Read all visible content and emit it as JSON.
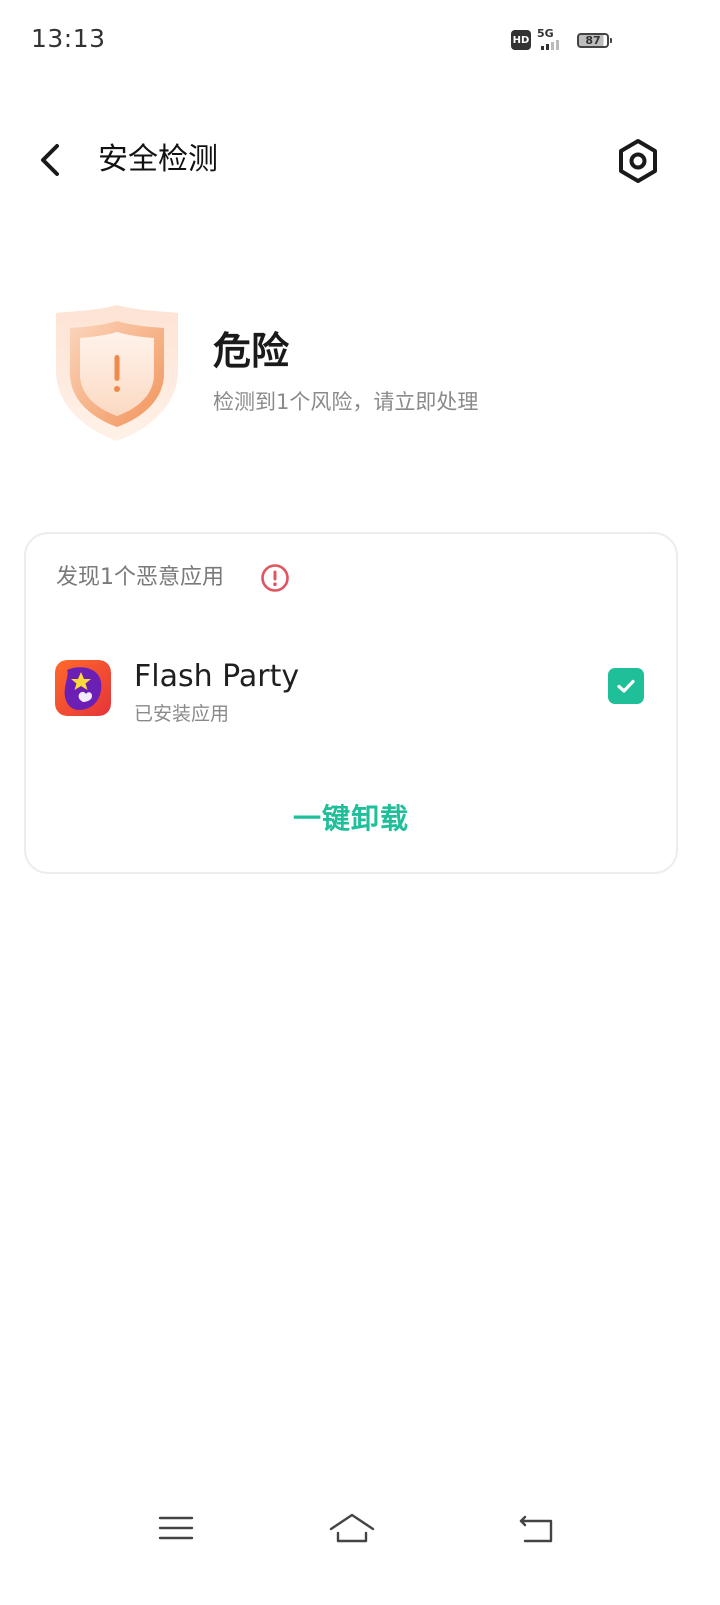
{
  "status_bar": {
    "time": "13:13",
    "hd_label": "HD",
    "network_label": "5G",
    "battery_level": "87"
  },
  "header": {
    "title": "安全检测",
    "back_icon": "chevron-left-icon",
    "settings_icon": "settings-icon"
  },
  "risk_summary": {
    "status": "危险",
    "description": "检测到1个风险，请立即处理",
    "icon": "shield-warning-icon",
    "accent_color": "#f08a4b"
  },
  "malware_card": {
    "heading": "发现1个恶意应用",
    "alert_icon": "alert-circle-icon",
    "alert_color": "#e0555f",
    "apps": [
      {
        "name": "Flash Party",
        "subtitle": "已安装应用",
        "checked": true
      }
    ],
    "action_label": "一键卸载",
    "action_color": "#1fbf9a"
  },
  "nav_bar": {
    "items": [
      "menu-icon",
      "home-icon",
      "back-icon"
    ]
  }
}
